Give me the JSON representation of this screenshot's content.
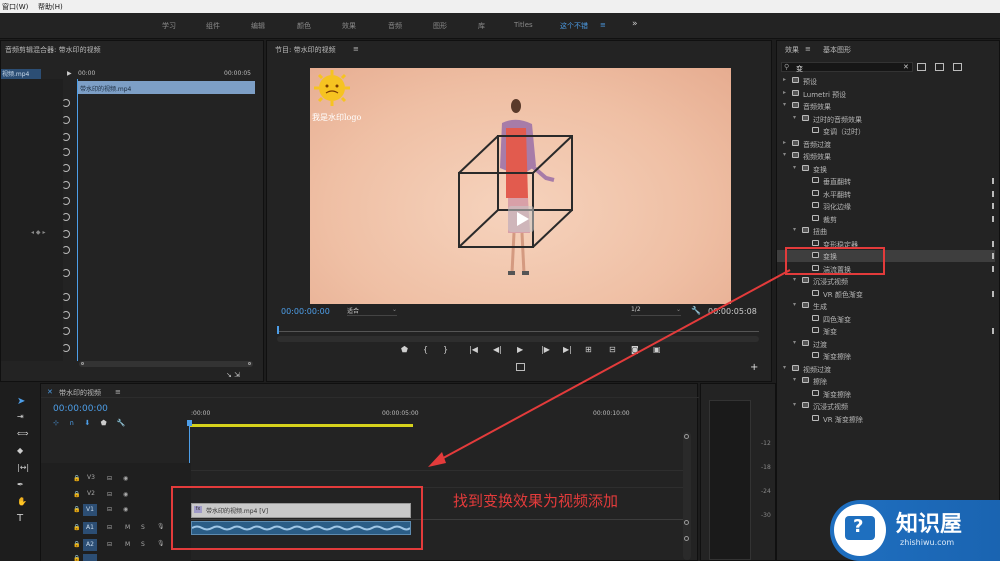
{
  "menu": {
    "window": "窗口(W)",
    "help": "帮助(H)"
  },
  "workspaces": [
    {
      "label": "学习"
    },
    {
      "label": "组件"
    },
    {
      "label": "编辑"
    },
    {
      "label": "颜色"
    },
    {
      "label": "效果"
    },
    {
      "label": "音频"
    },
    {
      "label": "图形"
    },
    {
      "label": "库"
    },
    {
      "label": "Titles"
    },
    {
      "label": "这个不错"
    }
  ],
  "workspace_menu": "≡",
  "workspace_more": "»",
  "audio_mixer": {
    "title": "音频剪辑混合器: 带水印的视频",
    "clip_name": "视频.mp4",
    "time_start": "00:00",
    "time_end": "00:00:05",
    "clip_block": "带水印的视频.mp4"
  },
  "program": {
    "title": "节目: 带水印的视频",
    "menu": "≡",
    "timecode": "00:00:00:00",
    "fit": "适合",
    "resolution": "1/2",
    "duration": "00:00:05:08",
    "watermark_text": "我是水印logo"
  },
  "effects": {
    "tab_effects": "效果",
    "tab_menu": "≡",
    "tab_graphics": "基本图形",
    "search_value": "变",
    "clear": "✕",
    "tree": [
      {
        "level": 0,
        "icon": "folder",
        "label": "预设"
      },
      {
        "level": 0,
        "icon": "folder",
        "label": "Lumetri 预设"
      },
      {
        "level": 0,
        "icon": "folder",
        "label": "音频效果",
        "open": true
      },
      {
        "level": 1,
        "icon": "folder",
        "label": "过时的音频效果",
        "open": true
      },
      {
        "level": 2,
        "icon": "fx",
        "label": "变调（过时）"
      },
      {
        "level": 0,
        "icon": "folder",
        "label": "音频过渡"
      },
      {
        "level": 0,
        "icon": "folder",
        "label": "视频效果",
        "open": true
      },
      {
        "level": 1,
        "icon": "folder",
        "label": "变换",
        "open": true
      },
      {
        "level": 2,
        "icon": "fx",
        "label": "垂直翻转",
        "pin": true
      },
      {
        "level": 2,
        "icon": "fx",
        "label": "水平翻转",
        "pin": true
      },
      {
        "level": 2,
        "icon": "fx",
        "label": "羽化边缘",
        "pin": true
      },
      {
        "level": 2,
        "icon": "fx",
        "label": "裁剪",
        "pin": true
      },
      {
        "level": 1,
        "icon": "folder",
        "label": "扭曲",
        "open": true
      },
      {
        "level": 2,
        "icon": "fx",
        "label": "变形稳定器",
        "pin": true
      },
      {
        "level": 2,
        "icon": "fx",
        "label": "变换",
        "pin": true,
        "selected": true
      },
      {
        "level": 2,
        "icon": "fx",
        "label": "湍流置换",
        "pin": true
      },
      {
        "level": 1,
        "icon": "folder",
        "label": "沉浸式视频",
        "open": true
      },
      {
        "level": 2,
        "icon": "fx",
        "label": "VR 颜色渐变",
        "pin": true
      },
      {
        "level": 1,
        "icon": "folder",
        "label": "生成",
        "open": true
      },
      {
        "level": 2,
        "icon": "fx",
        "label": "四色渐变"
      },
      {
        "level": 2,
        "icon": "fx",
        "label": "渐变",
        "pin": true
      },
      {
        "level": 1,
        "icon": "folder",
        "label": "过渡",
        "open": true
      },
      {
        "level": 2,
        "icon": "fx",
        "label": "渐变擦除"
      },
      {
        "level": 0,
        "icon": "folder",
        "label": "视频过渡",
        "open": true
      },
      {
        "level": 1,
        "icon": "folder",
        "label": "擦除",
        "open": true
      },
      {
        "level": 2,
        "icon": "fx",
        "label": "渐变擦除"
      },
      {
        "level": 1,
        "icon": "folder",
        "label": "沉浸式视频",
        "open": true
      },
      {
        "level": 2,
        "icon": "fx",
        "label": "VR 渐变擦除"
      }
    ]
  },
  "timeline": {
    "title": "带水印的视频",
    "menu": "≡",
    "timecode": "00:00:00:00",
    "ruler": [
      ":00:00",
      "00:00:05:00",
      "00:00:10:00"
    ],
    "video_tracks": [
      "V3",
      "V2",
      "V1"
    ],
    "audio_tracks": [
      "A1",
      "A2"
    ],
    "track_m": "M",
    "track_s": "S",
    "video_clip": "带水印的视频.mp4 [V]",
    "video_clip_badge": "fx",
    "annotation": "找到变换效果为视频添加"
  },
  "meter": {
    "ticks": [
      "-12",
      "-18",
      "-24",
      "-30"
    ]
  },
  "logo": {
    "cn": "知识屋",
    "en": "zhishiwu.com"
  },
  "colors": {
    "accent": "#4d9ee8",
    "annotation": "#e33b3b",
    "track_blue": "#2c4e74",
    "preview_bg": "#f1c6ad",
    "logo_blue": "#1e6fbf"
  }
}
